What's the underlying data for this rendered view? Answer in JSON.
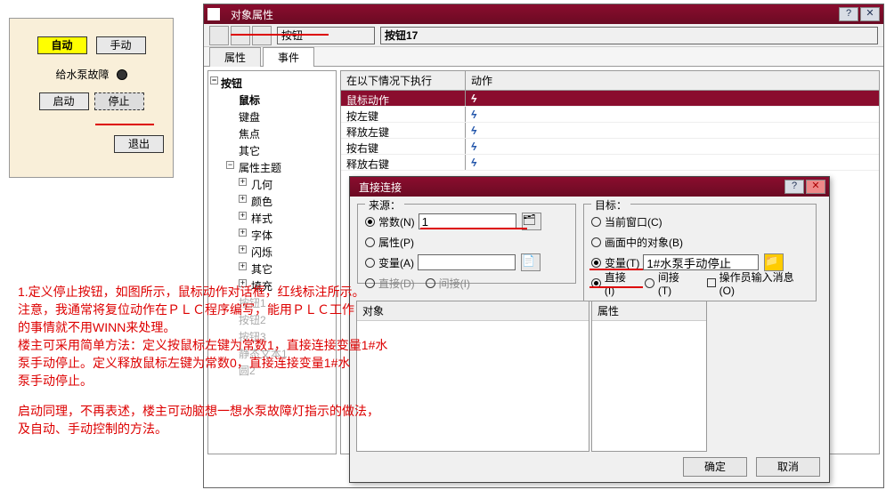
{
  "left_panel": {
    "auto": "自动",
    "manual": "手动",
    "fault_label": "给水泵故障",
    "start": "启动",
    "stop": "停止",
    "exit": "退出"
  },
  "annotation": {
    "p1": "1.定义停止按钮，如图所示，鼠标动作对话框，红线标注所示。",
    "p2": "注意，我通常将复位动作在ＰＬＣ程序编写，能用ＰＬＣ工作",
    "p3": "的事情就不用WINN来处理。",
    "p4": "楼主可采用简单方法：定义按鼠标左键为常数1，直接连接变量1#水",
    "p5": "泵手动停止。定义释放鼠标左键为常数0，直接连接变量1#水",
    "p6": "泵手动停止。",
    "p7": "启动同理，不再表述，楼主可动脑想一想水泵故障灯指示的做法，",
    "p8": "及自动、手动控制的方法。"
  },
  "dialog1": {
    "title": "对象属性",
    "obj_type": "按钮",
    "obj_name": "按钮17",
    "tabs": {
      "properties": "属性",
      "events": "事件"
    },
    "tree": {
      "root": "按钮",
      "mouse": "鼠标",
      "keyboard": "键盘",
      "focus": "焦点",
      "misc": "其它",
      "prop_theme": "属性主题",
      "sub": {
        "geom": "几何",
        "color": "颜色",
        "style": "样式",
        "font": "字体",
        "flash": "闪烁",
        "misc2": "其它",
        "fill": "填充"
      },
      "greyed": {
        "e1": "按钮1",
        "e2": "按钮2",
        "e3": "按钮3",
        "e4": "静态文本1",
        "e5": "圆2"
      }
    },
    "event_table": {
      "h1": "在以下情况下执行",
      "h2": "动作",
      "rows": [
        {
          "label": "鼠标动作",
          "selected": true
        },
        {
          "label": "按左键"
        },
        {
          "label": "释放左键"
        },
        {
          "label": "按右键"
        },
        {
          "label": "释放右键"
        }
      ]
    }
  },
  "dialog2": {
    "title": "直接连接",
    "source": {
      "label": "来源：",
      "constant": "常数(N)",
      "constant_val": "1",
      "property": "属性(P)",
      "variable": "变量(A)",
      "direct": "直接(D)",
      "indirect": "间接(I)"
    },
    "target": {
      "label": "目标：",
      "current_window": "当前窗口(C)",
      "screen_object": "画面中的对象(B)",
      "variable": "变量(T)",
      "variable_val": "1#水泵手动停止",
      "direct": "直接(I)",
      "indirect": "间接(T)",
      "operator_msg": "操作员输入消息(O)"
    },
    "lists": {
      "object": "对象",
      "property": "属性"
    },
    "ok": "确定",
    "cancel": "取消"
  }
}
